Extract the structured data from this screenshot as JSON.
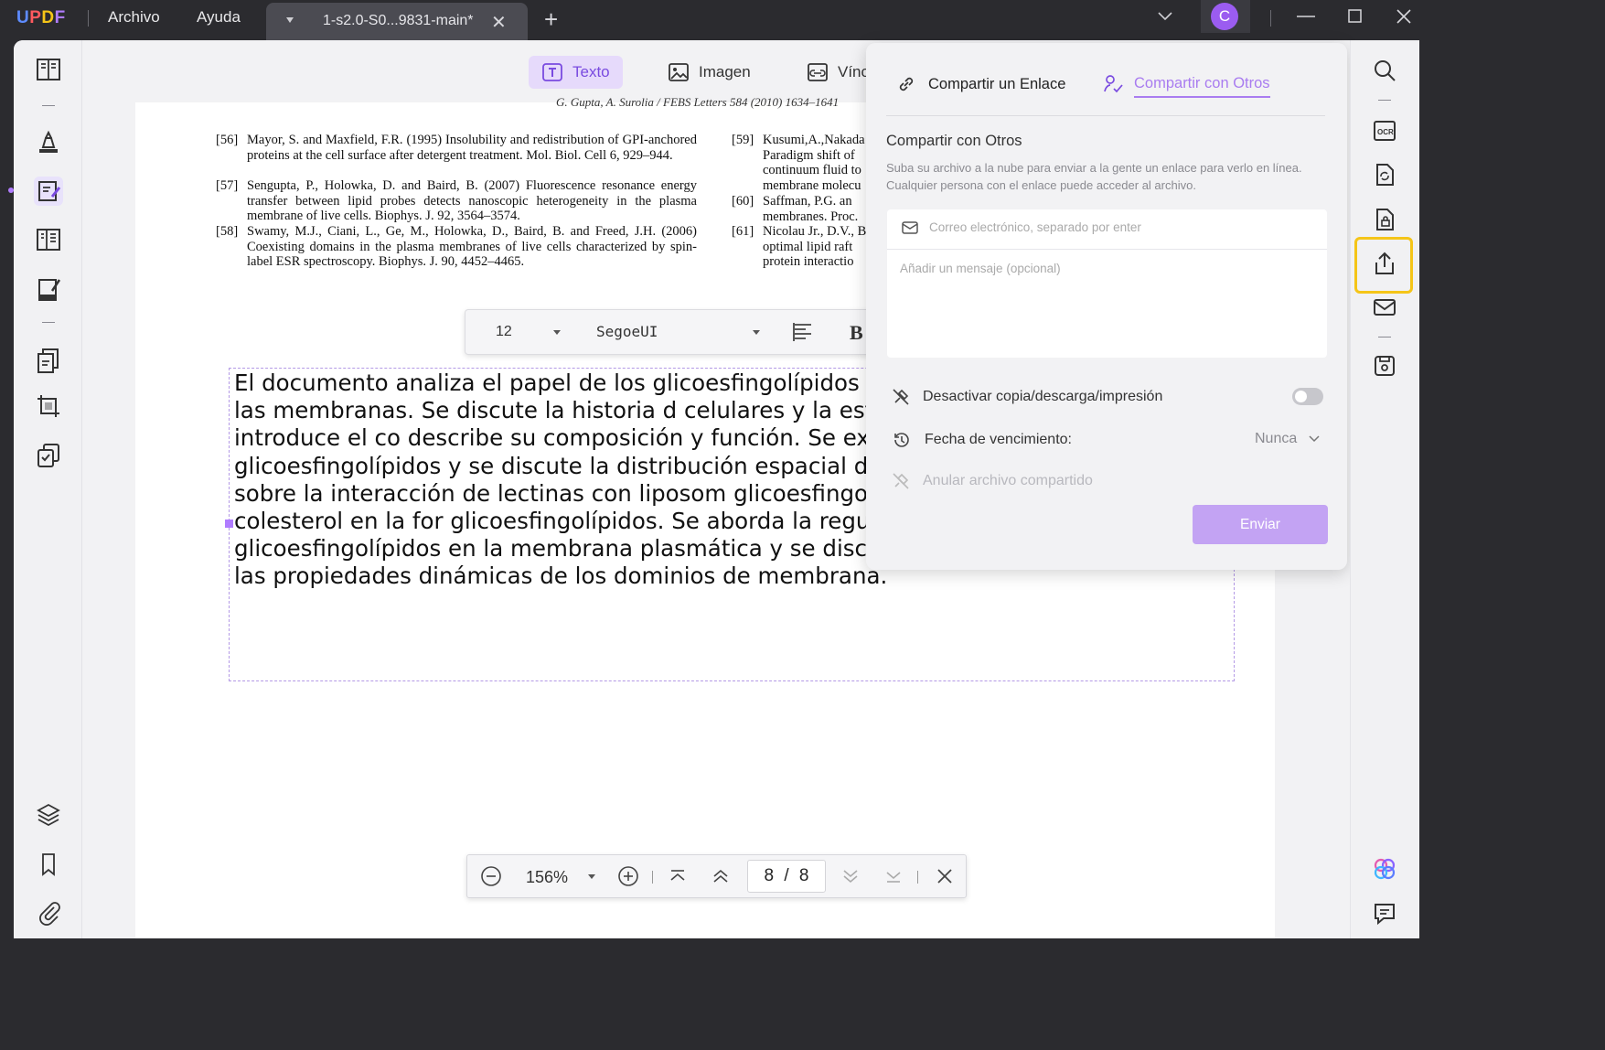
{
  "app": {
    "logo": "UPDF",
    "menu": [
      "Archivo",
      "Ayuda"
    ],
    "tab_label": "1-s2.0-S0...9831-main*",
    "user_initial": "C"
  },
  "top_modes": [
    {
      "label": "Texto",
      "active": true
    },
    {
      "label": "Imagen",
      "active": false
    },
    {
      "label": "Vínc",
      "active": false
    }
  ],
  "document": {
    "running_head": "G. Gupta, A. Surolia / FEBS Letters 584 (2010) 1634–1641",
    "references_left": [
      {
        "num": "[56]",
        "text": "Mayor, S. and Maxfield, F.R. (1995) Insolubility and redistribution of GPI-anchored proteins at the cell surface after detergent treatment. Mol. Biol. Cell 6, 929–944."
      },
      {
        "num": "[57]",
        "text": "Sengupta, P., Holowka, D. and Baird, B. (2007) Fluorescence resonance energy transfer between lipid probes detects nanoscopic heterogeneity in the plasma membrane of live cells. Biophys. J. 92, 3564–3574."
      },
      {
        "num": "[58]",
        "text": "Swamy, M.J., Ciani, L., Ge, M., Holowka, D., Baird, B. and Freed, J.H. (2006) Coexisting domains in the plasma membranes of live cells characterized by spin-label ESR spectroscopy. Biophys. J. 90, 4452–4465."
      }
    ],
    "references_right": [
      {
        "num": "[59]",
        "text": "Kusumi,A.,Nakada Paradigm shift of continuum fluid to membrane molecu"
      },
      {
        "num": "[60]",
        "text": "Saffman, P.G. an membranes. Proc."
      },
      {
        "num": "[61]",
        "text": "Nicolau Jr., D.V., B optimal lipid raft protein interactio"
      }
    ],
    "edit_text": "El documento analiza el papel de los glicoesfingolípidos en la f organización espacial en las membranas. Se discute la historia d celulares y la estructura de la bicapa lipídica. Se introduce el co describe su composición y función. Se examina la formación de glicoesfingolípidos y se discute la distribución espacial de estos presentan estudios sobre la interacción de lectinas con liposom glicoesfingolípidos y se discute el papel del colesterol en la for glicoesfingolípidos. Se aborda la regulación de la composición de los glicoesfingolípidos en la membrana plasmática y se discute la organización espacial y las propiedades dinámicas de los dominios de membrana."
  },
  "font_toolbar": {
    "size": "12",
    "family": "SegoeUI",
    "bold_label": "B"
  },
  "share_panel": {
    "tabs": [
      {
        "label": "Compartir un Enlace",
        "selected": false
      },
      {
        "label": "Compartir con Otros",
        "selected": true
      }
    ],
    "title": "Compartir con Otros",
    "description": "Suba su archivo a la nube para enviar a la gente un enlace para verlo en línea. Cualquier persona con el enlace puede acceder al archivo.",
    "email_placeholder": "Correo electrónico, separado por enter",
    "message_placeholder": "Añadir un mensaje (opcional)",
    "disable_copy_label": "Desactivar copia/descarga/impresión",
    "disable_copy_on": false,
    "expiry_label": "Fecha de vencimiento:",
    "expiry_value": "Nunca",
    "revoke_label": "Anular archivo compartido",
    "send_label": "Enviar"
  },
  "nav": {
    "zoom": "156%",
    "current_page": "8",
    "separator": "/",
    "total_pages": "8"
  },
  "colors": {
    "accent": "#a97cf0",
    "highlight": "#f5c518",
    "send_button": "#c3a3f3"
  }
}
